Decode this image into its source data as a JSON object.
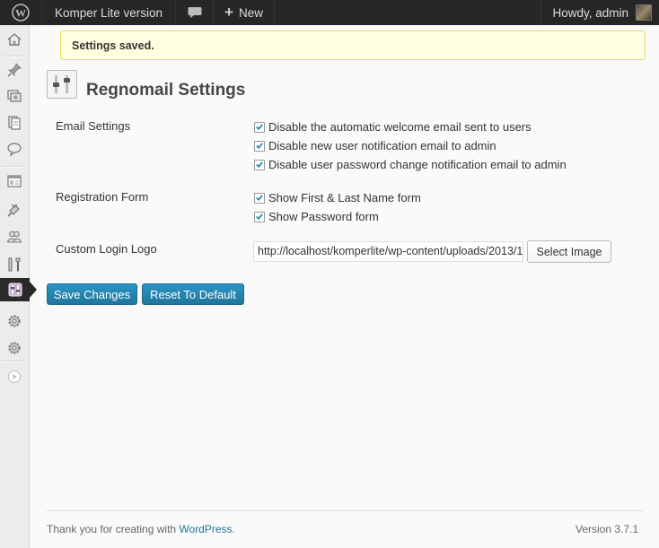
{
  "adminbar": {
    "site_name": "Komper Lite version",
    "new_label": "New",
    "howdy": "Howdy, admin"
  },
  "sidebar": {
    "items": [
      {
        "icon": "dashboard-icon"
      },
      {
        "icon": "posts-pin-icon"
      },
      {
        "icon": "media-icon"
      },
      {
        "icon": "pages-icon"
      },
      {
        "icon": "comments-icon"
      },
      {
        "icon": "appearance-icon"
      },
      {
        "icon": "plugins-icon"
      },
      {
        "icon": "users-icon"
      },
      {
        "icon": "tools-icon"
      },
      {
        "icon": "regnomail-icon",
        "current": true
      },
      {
        "icon": "settings-icon"
      },
      {
        "icon": "settings-icon"
      },
      {
        "icon": "collapse-icon"
      }
    ]
  },
  "notice": "Settings saved.",
  "page_title": "Regnomail Settings",
  "email_settings": {
    "label": "Email Settings",
    "options": [
      {
        "label": "Disable the automatic welcome email sent to users",
        "checked": true
      },
      {
        "label": "Disable new user notification email to admin",
        "checked": true
      },
      {
        "label": "Disable user password change notification email to admin",
        "checked": true
      }
    ]
  },
  "registration_form": {
    "label": "Registration Form",
    "options": [
      {
        "label": "Show First & Last Name form",
        "checked": true
      },
      {
        "label": "Show Password form",
        "checked": true
      }
    ]
  },
  "custom_login_logo": {
    "label": "Custom Login Logo",
    "value": "http://localhost/komperlite/wp-content/uploads/2013/1",
    "button": "Select Image"
  },
  "actions": {
    "save": "Save Changes",
    "reset": "Reset To Default"
  },
  "footer": {
    "thanks_prefix": "Thank you for creating with ",
    "wordpress_link": "WordPress",
    "thanks_suffix": ".",
    "version": "Version 3.7.1"
  },
  "colors": {
    "primary_button": "#21759b",
    "notice_bg": "#ffffe0",
    "adminbar_bg": "#262626"
  }
}
